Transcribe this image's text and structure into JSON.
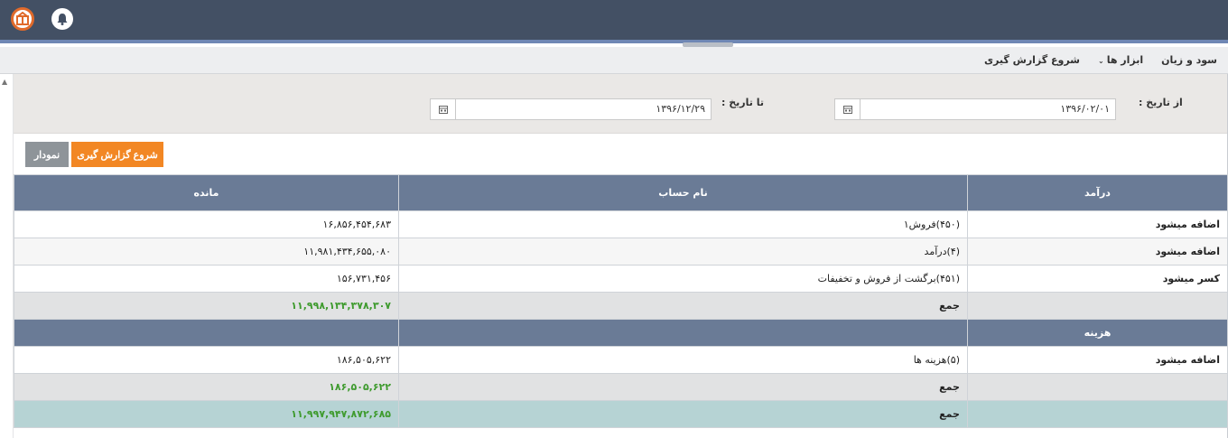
{
  "header": {
    "logo_icon": "app-logo-icon",
    "bell_icon": "bell-icon"
  },
  "menu": {
    "items": [
      {
        "label": "سود و زیان"
      },
      {
        "label": "ابزار ها",
        "has_dropdown": true
      },
      {
        "label": "شروع گزارش گیری"
      }
    ]
  },
  "filter": {
    "from_label": "از تاریخ :",
    "from_value": "۱۳۹۶/۰۲/۰۱",
    "to_label": "تا تاریخ :",
    "to_value": "۱۳۹۶/۱۲/۲۹",
    "calendar_icon": "calendar-icon"
  },
  "buttons": {
    "start_report": "شروع گزارش گیری",
    "chart": "نمودار"
  },
  "table": {
    "income_header": {
      "section": "درآمد",
      "account": "نام حساب",
      "balance": "مانده"
    },
    "income_rows": [
      {
        "type": "اضافه میشود",
        "account": "(۴۵۰)فروش۱",
        "balance": "۱۶,۸۵۶,۴۵۴,۶۸۳"
      },
      {
        "type": "اضافه میشود",
        "account": "(۴)درآمد",
        "balance": "۱۱,۹۸۱,۴۳۴,۶۵۵,۰۸۰"
      },
      {
        "type": "کسر میشود",
        "account": "(۴۵۱)برگشت از فروش و تخفیفات",
        "balance": "۱۵۶,۷۳۱,۴۵۶"
      }
    ],
    "income_sum": {
      "label": "جمع",
      "balance": "۱۱,۹۹۸,۱۳۴,۳۷۸,۳۰۷"
    },
    "expense_header": {
      "section": "هزینه"
    },
    "expense_rows": [
      {
        "type": "اضافه میشود",
        "account": "(۵)هزینه ها",
        "balance": "۱۸۶,۵۰۵,۶۲۲"
      }
    ],
    "expense_sum": {
      "label": "جمع",
      "balance": "۱۸۶,۵۰۵,۶۲۲"
    },
    "total": {
      "label": "جمع",
      "balance": "۱۱,۹۹۷,۹۴۷,۸۷۲,۶۸۵"
    }
  }
}
